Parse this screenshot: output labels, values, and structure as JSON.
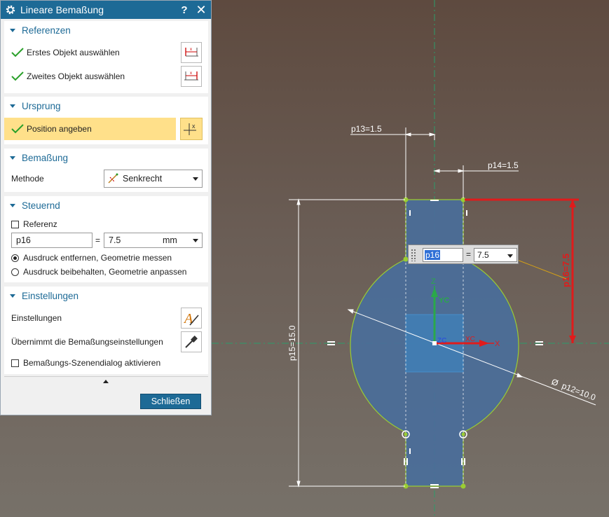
{
  "dialog": {
    "title": "Lineare Bemaßung",
    "help_label": "?",
    "close_label": "✕",
    "sections": {
      "referenzen": {
        "title": "Referenzen",
        "first_object": "Erstes Objekt auswählen",
        "second_object": "Zweites Objekt auswählen"
      },
      "ursprung": {
        "title": "Ursprung",
        "position": "Position angeben"
      },
      "bemassung": {
        "title": "Bemaßung",
        "method_label": "Methode",
        "method_value": "Senkrecht"
      },
      "steuernd": {
        "title": "Steuernd",
        "reference_label": "Referenz",
        "reference_checked": false,
        "expression_name": "p16",
        "equals": "=",
        "expression_value": "7.5",
        "unit": "mm",
        "radio_remove": "Ausdruck entfernen, Geometrie messen",
        "radio_keep": "Ausdruck beibehalten, Geometrie anpassen",
        "radio_selected": "remove"
      },
      "einstellungen": {
        "title": "Einstellungen",
        "settings_label": "Einstellungen",
        "inherit_label": "Übernimmt die Bemaßungseinstellungen",
        "scene_dialog_label": "Bemaßungs-Szenendialog aktivieren",
        "scene_dialog_checked": false
      }
    },
    "close_button": "Schließen"
  },
  "canvas": {
    "dimensions": {
      "p13": "p13=1.5",
      "p14": "p14=1.5",
      "p15": "p15=15.0",
      "p12": "p12=10.0",
      "p16": "p16=7.5",
      "diameter_symbol": "Ø"
    },
    "axes": {
      "z": "Z",
      "yc": "YC",
      "zc": "ZC",
      "xc": "XC",
      "x": "X"
    },
    "onscreen_input": {
      "name": "p16",
      "equals": "=",
      "value": "7.5"
    },
    "colors": {
      "body_fill": "#4a6e9a",
      "sketch_edge": "#9acd32",
      "active_dimension": "#e01b1b",
      "dimension": "#ffffff"
    }
  }
}
